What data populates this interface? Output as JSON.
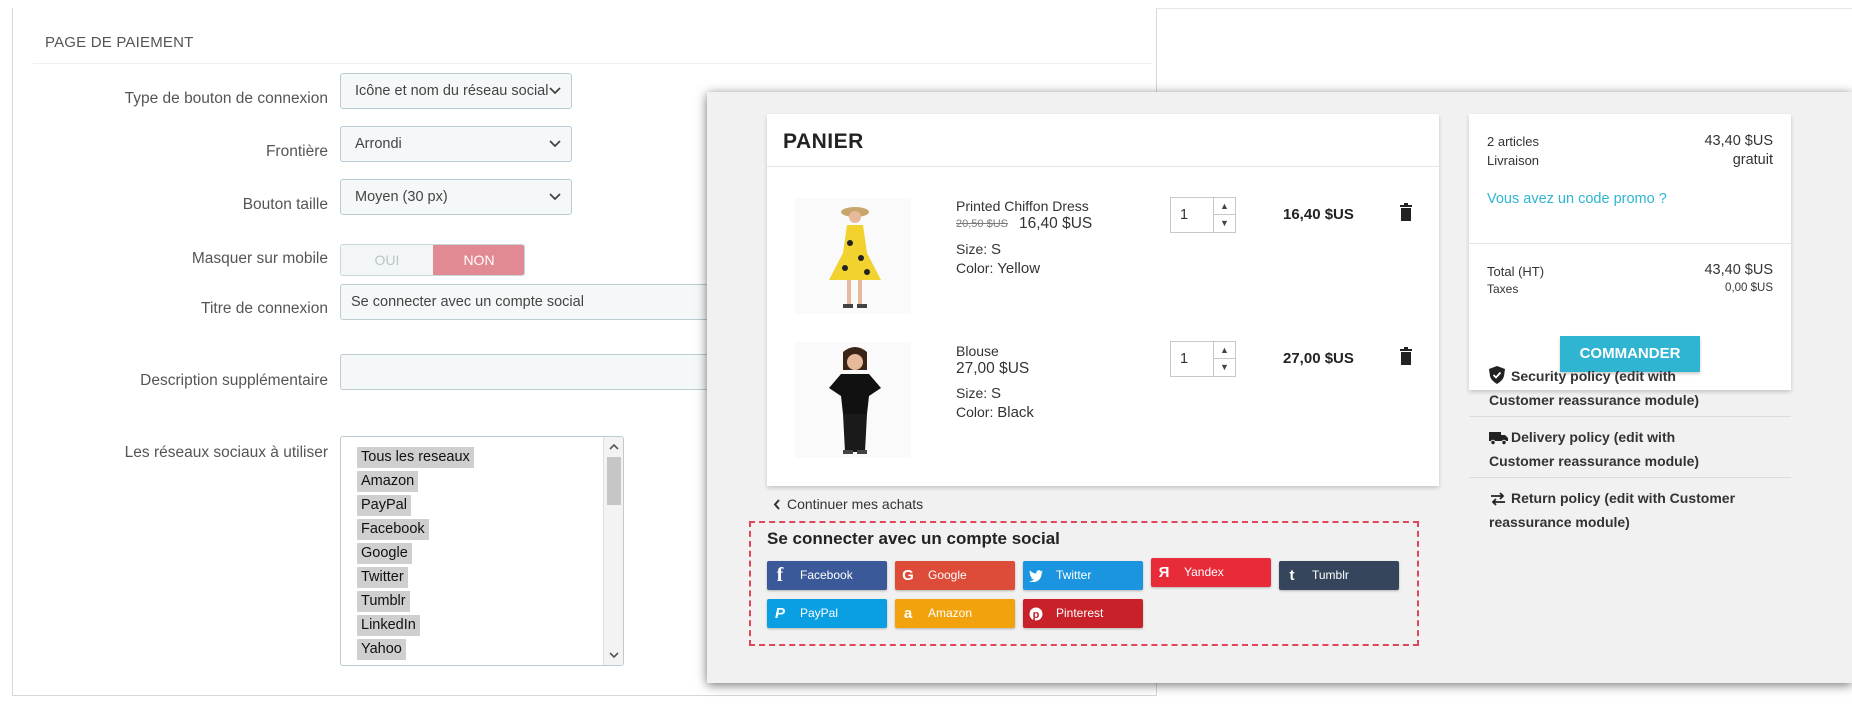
{
  "admin": {
    "section_title": "PAGE DE PAIEMENT",
    "fields": {
      "button_type": {
        "label": "Type de bouton de connexion",
        "value": "Icône et nom du réseau social"
      },
      "border": {
        "label": "Frontière",
        "value": "Arrondi"
      },
      "button_size": {
        "label": "Bouton taille",
        "value": "Moyen (30 px)"
      },
      "hide_mobile": {
        "label": "Masquer sur mobile",
        "yes": "OUI",
        "no": "NON",
        "selected": "NON"
      },
      "login_title": {
        "label": "Titre de connexion",
        "value": "Se connecter avec un compte social"
      },
      "extra_description": {
        "label": "Description supplémentaire",
        "value": ""
      },
      "networks": {
        "label": "Les réseaux sociaux à utiliser",
        "options": [
          "Tous les reseaux",
          "Amazon",
          "PayPal",
          "Facebook",
          "Google",
          "Twitter",
          "Tumblr",
          "LinkedIn",
          "Yahoo"
        ]
      }
    }
  },
  "cart": {
    "title": "PANIER",
    "items": [
      {
        "name": "Printed Chiffon Dress",
        "old_price": "20,50 $US",
        "price": "16,40 $US",
        "size_label": "Size:",
        "size": "S",
        "color_label": "Color:",
        "color": "Yellow",
        "qty": "1",
        "total": "16,40 $US"
      },
      {
        "name": "Blouse",
        "old_price": "",
        "price": "27,00 $US",
        "size_label": "Size:",
        "size": "S",
        "color_label": "Color:",
        "color": "Black",
        "qty": "1",
        "total": "27,00 $US"
      }
    ],
    "continue_label": "Continuer mes achats"
  },
  "social": {
    "title": "Se connecter avec un compte social",
    "buttons": [
      {
        "label": "Facebook",
        "color": "#3b5998",
        "icon": "facebook-icon"
      },
      {
        "label": "Google",
        "color": "#dd4b39",
        "icon": "google-icon"
      },
      {
        "label": "Twitter",
        "color": "#1b95e0",
        "icon": "twitter-icon"
      },
      {
        "label": "Yandex",
        "color": "#e82b38",
        "icon": "yandex-icon"
      },
      {
        "label": "Tumblr",
        "color": "#35465c",
        "icon": "tumblr-icon"
      },
      {
        "label": "PayPal",
        "color": "#0a9ee3",
        "icon": "paypal-icon"
      },
      {
        "label": "Amazon",
        "color": "#f2a20c",
        "icon": "amazon-icon"
      },
      {
        "label": "Pinterest",
        "color": "#c9212a",
        "icon": "pinterest-icon"
      }
    ]
  },
  "summary": {
    "articles_label": "2 articles",
    "articles_value": "43,40 $US",
    "shipping_label": "Livraison",
    "shipping_value": "gratuit",
    "promo_link": "Vous avez un code promo ?",
    "total_label": "Total (HT)",
    "total_value": "43,40 $US",
    "tax_label": "Taxes",
    "tax_value": "0,00 $US",
    "order_button": "COMMANDER"
  },
  "reassurance": [
    {
      "line1": "Security policy (edit with",
      "line2": "Customer reassurance module)",
      "icon": "shield-icon"
    },
    {
      "line1": "Delivery policy (edit with",
      "line2": "Customer reassurance module)",
      "icon": "truck-icon"
    },
    {
      "line1": "Return policy (edit with Customer",
      "line2": "reassurance module)",
      "icon": "swap-arrows-icon"
    }
  ],
  "colors": {
    "accent": "#2fb5d2",
    "switch_off": "#e28a93",
    "dashed_highlight": "#e0475a"
  }
}
